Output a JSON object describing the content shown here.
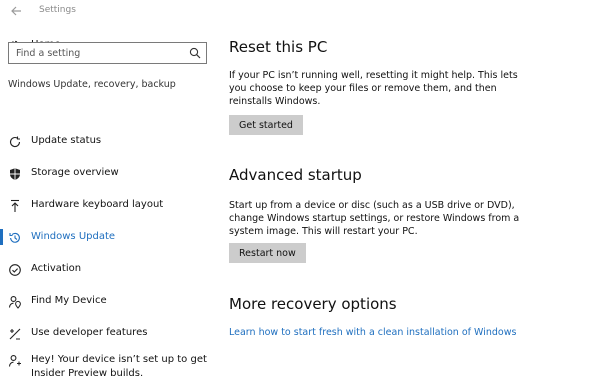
{
  "window": {
    "title": "Settings",
    "back_icon": "back-arrow-icon"
  },
  "sidebar": {
    "home": {
      "label": "Home",
      "icon": "gear-icon"
    },
    "search": {
      "placeholder": "Find a setting",
      "value": "",
      "icon": "search-icon"
    },
    "section_heading": "Windows Update, recovery, backup",
    "items": [
      {
        "label": "Update status",
        "icon": "refresh-icon",
        "active": false
      },
      {
        "label": "Storage overview",
        "icon": "shield-icon",
        "active": false
      },
      {
        "label": "Hardware keyboard layout",
        "icon": "upload-arrow-icon",
        "active": false
      },
      {
        "label": "Windows Update",
        "icon": "history-clock-icon",
        "active": true
      },
      {
        "label": "Activation",
        "icon": "checkmark-circle-icon",
        "active": false
      },
      {
        "label": "Find My Device",
        "icon": "person-location-icon",
        "active": false
      },
      {
        "label": "Use developer features",
        "icon": "developer-tools-icon",
        "active": false
      },
      {
        "label": "Hey! Your device isn’t set up to get Insider Preview builds.",
        "icon": "insider-person-icon",
        "active": false
      }
    ],
    "accent_color": "#1f6fbf"
  },
  "main": {
    "reset": {
      "title": "Reset this PC",
      "description": "If your PC isn’t running well, resetting it might help. This lets you choose to keep your files or remove them, and then reinstalls Windows.",
      "button_label": "Get started"
    },
    "advanced": {
      "title": "Advanced startup",
      "description": "Start up from a device or disc (such as a USB drive or DVD), change Windows startup settings, or restore Windows from a system image. This will restart your PC.",
      "button_label": "Restart now"
    },
    "more": {
      "title": "More recovery options",
      "link_label": "Learn how to start fresh with a clean installation of Windows"
    }
  }
}
